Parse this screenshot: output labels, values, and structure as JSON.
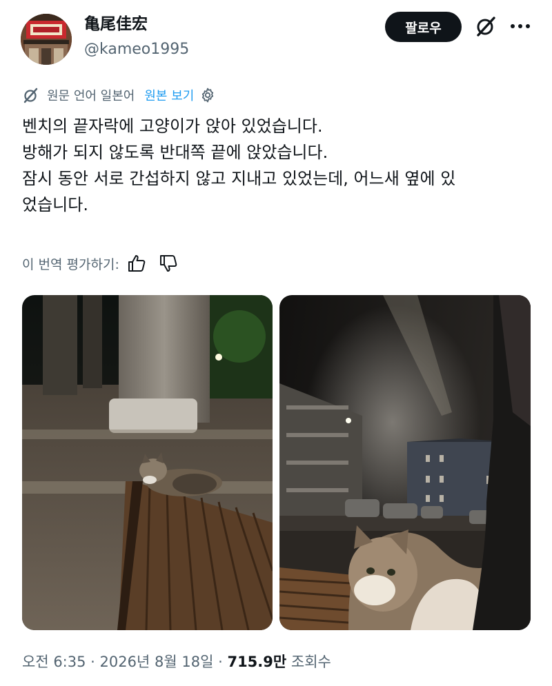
{
  "author": {
    "display_name": "亀尾佳宏",
    "handle": "@kameo1995"
  },
  "actions": {
    "follow_label": "팔로우",
    "grok_icon": "grok-icon",
    "more_icon": "more-dots-icon"
  },
  "translation": {
    "source_text": "원문 언어 일본어",
    "show_original_label": "원본 보기",
    "icon": "translate-slash-icon",
    "settings_icon": "gear-icon"
  },
  "tweet": {
    "lines": [
      "벤치의 끝자락에 고양이가 앉아 있었습니다.",
      "방해가 되지 않도록 반대쪽 끝에 앉았습니다.",
      "잠시 동안 서로 간섭하지 않고 지내고 있었는데, 어느새 옆에 있",
      "었습니다."
    ]
  },
  "rating": {
    "label": "이 번역 평가하기:",
    "like_icon": "thumbs-up-icon",
    "dislike_icon": "thumbs-down-icon"
  },
  "media": {
    "photos": [
      {
        "subject": "cat-on-bench-night-photo"
      },
      {
        "subject": "cat-closeup-night-photo"
      }
    ]
  },
  "meta": {
    "time": "오전 6:35",
    "sep1": "·",
    "date": "2026년 8월 18일",
    "sep2": "·",
    "views_count": "715.9만",
    "views_label": "조회수"
  },
  "colors": {
    "text": "#0f1419",
    "secondary": "#536471",
    "link": "#1d9bf0",
    "button_bg": "#0f1419"
  }
}
